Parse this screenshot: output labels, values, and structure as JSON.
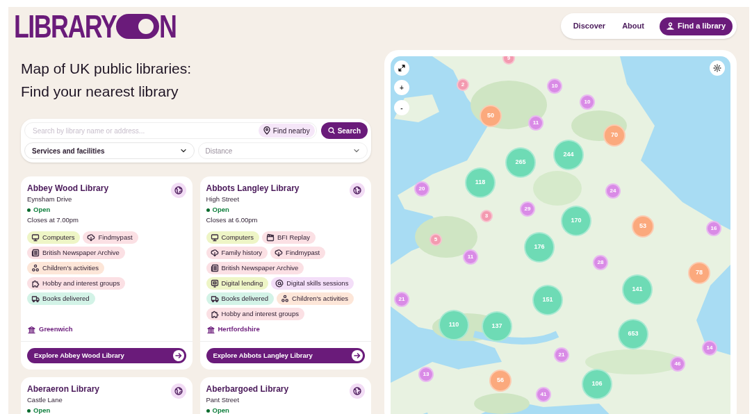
{
  "logo": {
    "text_before": "LIBRARY",
    "text_after": "N"
  },
  "nav": {
    "links": [
      "Discover",
      "About"
    ],
    "cta": "Find a library"
  },
  "heading": [
    "Map of UK public libraries:",
    "Find your nearest library"
  ],
  "search": {
    "placeholder": "Search by library name or address...",
    "find_nearby": "Find nearby",
    "button": "Search",
    "services": "Services and facilities",
    "distance_placeholder": "Distance"
  },
  "libraries": [
    {
      "name": "Abbey Wood Library",
      "street": "Eynsham Drive",
      "status": "Open",
      "open": true,
      "closes": "Closes at 7.00pm",
      "tags": [
        {
          "label": "Computers",
          "color": "#eef5c6",
          "kind": "computer"
        },
        {
          "label": "Findmypast",
          "color": "#fbe0e4",
          "kind": "cloud"
        },
        {
          "label": "British Newspaper Archive",
          "color": "#fbe0e4",
          "kind": "newspaper"
        },
        {
          "label": "Children's activities",
          "color": "#fde6d8",
          "kind": "children"
        },
        {
          "label": "Hobby and interest groups",
          "color": "#fbe0e4",
          "kind": "puzzle"
        },
        {
          "label": "Books delivered",
          "color": "#d3f3e7",
          "kind": "van"
        }
      ],
      "authority": "Greenwich",
      "button": "Explore Abbey Wood Library"
    },
    {
      "name": "Abbots Langley Library",
      "street": "High Street",
      "status": "Open",
      "open": true,
      "closes": "Closes at 6.00pm",
      "tags": [
        {
          "label": "Computers",
          "color": "#eef5c6",
          "kind": "computer"
        },
        {
          "label": "BFI Replay",
          "color": "#fbe0e4",
          "kind": "film"
        },
        {
          "label": "Family history",
          "color": "#fbe0e4",
          "kind": "cloud"
        },
        {
          "label": "Findmypast",
          "color": "#fbe0e4",
          "kind": "cloud"
        },
        {
          "label": "British Newspaper Archive",
          "color": "#fbe0e4",
          "kind": "newspaper"
        },
        {
          "label": "Digital lending",
          "color": "#eef5c6",
          "kind": "tablet"
        },
        {
          "label": "Digital skills sessions",
          "color": "#f3def8",
          "kind": "at"
        },
        {
          "label": "Books delivered",
          "color": "#d3f3e7",
          "kind": "van"
        },
        {
          "label": "Children's activities",
          "color": "#fde6d8",
          "kind": "children"
        },
        {
          "label": "Hobby and interest groups",
          "color": "#fbe0e4",
          "kind": "puzzle"
        }
      ],
      "authority": "Hertfordshire",
      "button": "Explore Abbots Langley Library"
    },
    {
      "name": "Aberaeron Library",
      "street": "Castle Lane",
      "status": "Open",
      "open": true
    },
    {
      "name": "Aberbargoed Library",
      "street": "Pant Street",
      "status": "Open",
      "open": true
    }
  ],
  "map": {
    "controls": [
      "+",
      "-"
    ],
    "clusters": [
      {
        "count": "9",
        "color": "#f39ab0"
      },
      {
        "count": "2",
        "color": "#f39ab0"
      },
      {
        "count": "10",
        "color": "#d98be6"
      },
      {
        "count": "10",
        "color": "#d98be6"
      },
      {
        "count": "50",
        "color": "#fba97d"
      },
      {
        "count": "11",
        "color": "#d98be6"
      },
      {
        "count": "70",
        "color": "#fba97d"
      },
      {
        "count": "265",
        "color": "#6edbb5"
      },
      {
        "count": "244",
        "color": "#6edbb5"
      },
      {
        "count": "118",
        "color": "#6edbb5"
      },
      {
        "count": "20",
        "color": "#d98be6"
      },
      {
        "count": "24",
        "color": "#d98be6"
      },
      {
        "count": "29",
        "color": "#d98be6"
      },
      {
        "count": "3",
        "color": "#f39ab0"
      },
      {
        "count": "170",
        "color": "#6edbb5"
      },
      {
        "count": "53",
        "color": "#fba97d"
      },
      {
        "count": "16",
        "color": "#d98be6"
      },
      {
        "count": "5",
        "color": "#f39ab0"
      },
      {
        "count": "176",
        "color": "#6edbb5"
      },
      {
        "count": "11",
        "color": "#d98be6"
      },
      {
        "count": "28",
        "color": "#d98be6"
      },
      {
        "count": "141",
        "color": "#6edbb5"
      },
      {
        "count": "78",
        "color": "#fba97d"
      },
      {
        "count": "21",
        "color": "#d98be6"
      },
      {
        "count": "151",
        "color": "#6edbb5"
      },
      {
        "count": "110",
        "color": "#6edbb5"
      },
      {
        "count": "137",
        "color": "#6edbb5"
      },
      {
        "count": "653",
        "color": "#6edbb5"
      },
      {
        "count": "21",
        "color": "#d98be6"
      },
      {
        "count": "14",
        "color": "#d98be6"
      },
      {
        "count": "46",
        "color": "#d98be6"
      },
      {
        "count": "13",
        "color": "#d98be6"
      },
      {
        "count": "56",
        "color": "#fba97d"
      },
      {
        "count": "106",
        "color": "#6edbb5"
      },
      {
        "count": "41",
        "color": "#d98be6"
      }
    ]
  }
}
